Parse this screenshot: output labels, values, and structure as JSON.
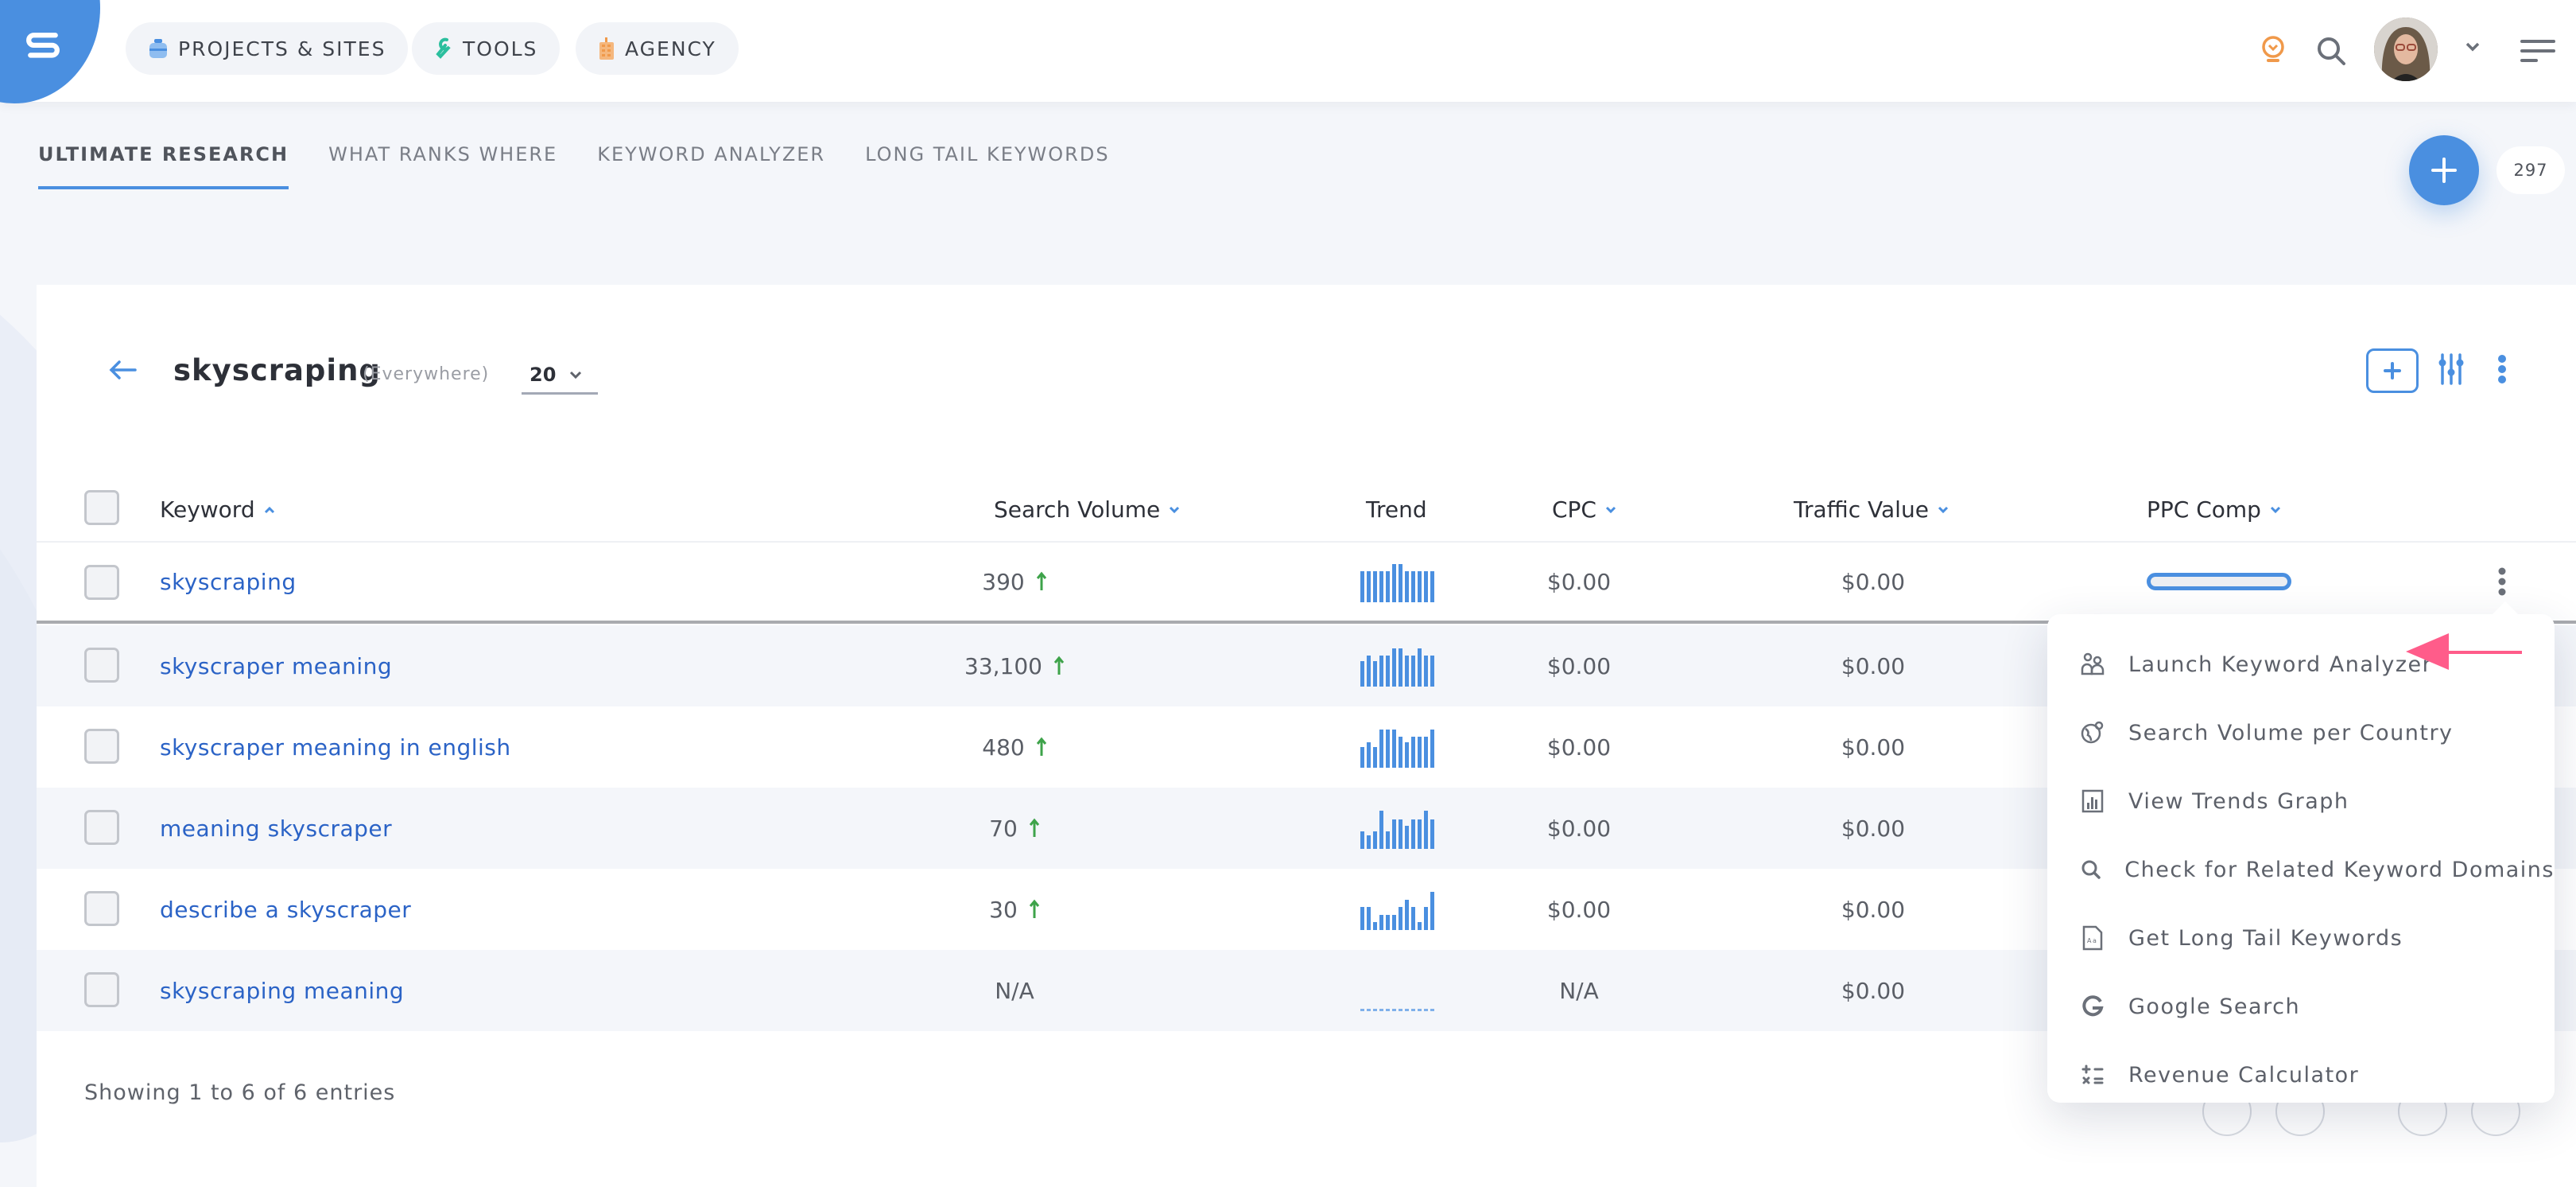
{
  "header": {
    "logo_label": "S",
    "nav": [
      {
        "label": "PROJECTS & SITES",
        "icon": "briefcase-icon",
        "color": "#4a8fe0"
      },
      {
        "label": "TOOLS",
        "icon": "wrench-icon",
        "color": "#2bbf9e"
      },
      {
        "label": "AGENCY",
        "icon": "building-icon",
        "color": "#f0994a"
      }
    ],
    "icons": [
      "lightbulb-icon",
      "search-icon",
      "avatar",
      "chevron-down-icon",
      "hamburger-menu-icon"
    ]
  },
  "tabs": [
    {
      "label": "ULTIMATE RESEARCH",
      "active": true
    },
    {
      "label": "WHAT RANKS WHERE",
      "active": false
    },
    {
      "label": "KEYWORD ANALYZER",
      "active": false
    },
    {
      "label": "LONG TAIL KEYWORDS",
      "active": false
    }
  ],
  "fab": {
    "count": "297"
  },
  "research": {
    "keyword": "skyscraping",
    "location": "(Everywhere)",
    "per_page": "20"
  },
  "table": {
    "columns": {
      "keyword": "Keyword",
      "search_volume": "Search Volume",
      "trend": "Trend",
      "cpc": "CPC",
      "traffic_value": "Traffic Value",
      "ppc_comp": "PPC Comp"
    },
    "rows": [
      {
        "keyword": "skyscraping",
        "volume": "390",
        "trend_up": true,
        "trend": [
          0.82,
          0.82,
          0.82,
          0.82,
          0.82,
          1.0,
          1.0,
          0.82,
          0.82,
          0.82,
          0.82,
          0.82
        ],
        "cpc": "$0.00",
        "traffic_value": "$0.00",
        "ppc_comp": 0
      },
      {
        "keyword": "skyscraper meaning",
        "volume": "33,100",
        "trend_up": true,
        "trend": [
          0.67,
          0.82,
          0.67,
          0.82,
          0.82,
          1.0,
          1.0,
          0.82,
          0.82,
          1.0,
          0.82,
          0.82
        ],
        "cpc": "$0.00",
        "traffic_value": "$0.00",
        "ppc_comp": 0
      },
      {
        "keyword": "skyscraper meaning in english",
        "volume": "480",
        "trend_up": true,
        "trend": [
          0.55,
          0.67,
          0.55,
          1.0,
          1.0,
          1.0,
          0.82,
          0.67,
          0.82,
          0.82,
          0.82,
          1.0
        ],
        "cpc": "$0.00",
        "traffic_value": "$0.00",
        "ppc_comp": 0
      },
      {
        "keyword": "meaning skyscraper",
        "volume": "70",
        "trend_up": true,
        "trend": [
          0.45,
          0.35,
          0.45,
          1.0,
          0.45,
          0.77,
          0.77,
          0.6,
          0.77,
          0.77,
          1.0,
          0.77
        ],
        "cpc": "$0.00",
        "traffic_value": "$0.00",
        "ppc_comp": 0
      },
      {
        "keyword": "describe a skyscraper",
        "volume": "30",
        "trend_up": true,
        "trend": [
          0.6,
          0.6,
          0.2,
          0.4,
          0.4,
          0.4,
          0.6,
          0.8,
          0.6,
          0.2,
          0.6,
          1.0,
          0.8
        ],
        "cpc": "$0.00",
        "traffic_value": "$0.00",
        "ppc_comp": 0
      },
      {
        "keyword": "skyscraping meaning",
        "volume": "N/A",
        "trend_up": false,
        "trend": [
          0,
          0,
          0,
          0,
          0,
          0,
          0,
          0,
          0,
          0,
          0,
          0
        ],
        "cpc": "N/A",
        "traffic_value": "$0.00",
        "ppc_comp": null
      }
    ]
  },
  "footer": {
    "showing": "Showing 1 to 6 of 6 entries"
  },
  "row_menu": {
    "items": [
      {
        "label": "Launch Keyword Analyzer",
        "icon": "users-icon"
      },
      {
        "label": "Search Volume per Country",
        "icon": "globe-pin-icon"
      },
      {
        "label": "View Trends Graph",
        "icon": "bar-chart-icon"
      },
      {
        "label": "Check for Related Keyword Domains",
        "icon": "search-domain-icon"
      },
      {
        "label": "Get Long Tail Keywords",
        "icon": "document-text-icon"
      },
      {
        "label": "Google Search",
        "icon": "google-icon"
      },
      {
        "label": "Revenue Calculator",
        "icon": "calculator-icon"
      }
    ],
    "highlight_color": "#ff5c8a"
  },
  "colors": {
    "accent": "#4a8fe0",
    "link": "#2b63c6",
    "trend_up": "#3ea34a"
  }
}
